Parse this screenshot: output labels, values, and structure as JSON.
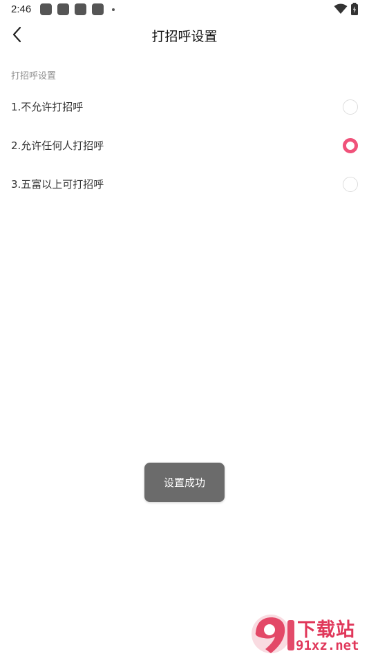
{
  "status_bar": {
    "time": "2:46",
    "notification_icons": [
      "app-icon",
      "app-icon",
      "app-icon",
      "app-icon",
      "more-dot-icon"
    ],
    "wifi_icon": "wifi-icon",
    "battery_icon": "battery-charging-icon"
  },
  "app_bar": {
    "back_icon": "chevron-left-icon",
    "title": "打招呼设置"
  },
  "section": {
    "label": "打招呼设置"
  },
  "options": [
    {
      "label": "1.不允许打招呼",
      "selected": false
    },
    {
      "label": "2.允许任何人打招呼",
      "selected": true
    },
    {
      "label": "3.五富以上可打招呼",
      "selected": false
    }
  ],
  "toast": {
    "text": "设置成功"
  },
  "watermark": {
    "logo_text": "下载站",
    "url_text": "91xz.net"
  },
  "colors": {
    "accent": "#f0527a",
    "toast_bg": "#6b6b6b",
    "watermark": "#e0375a"
  }
}
